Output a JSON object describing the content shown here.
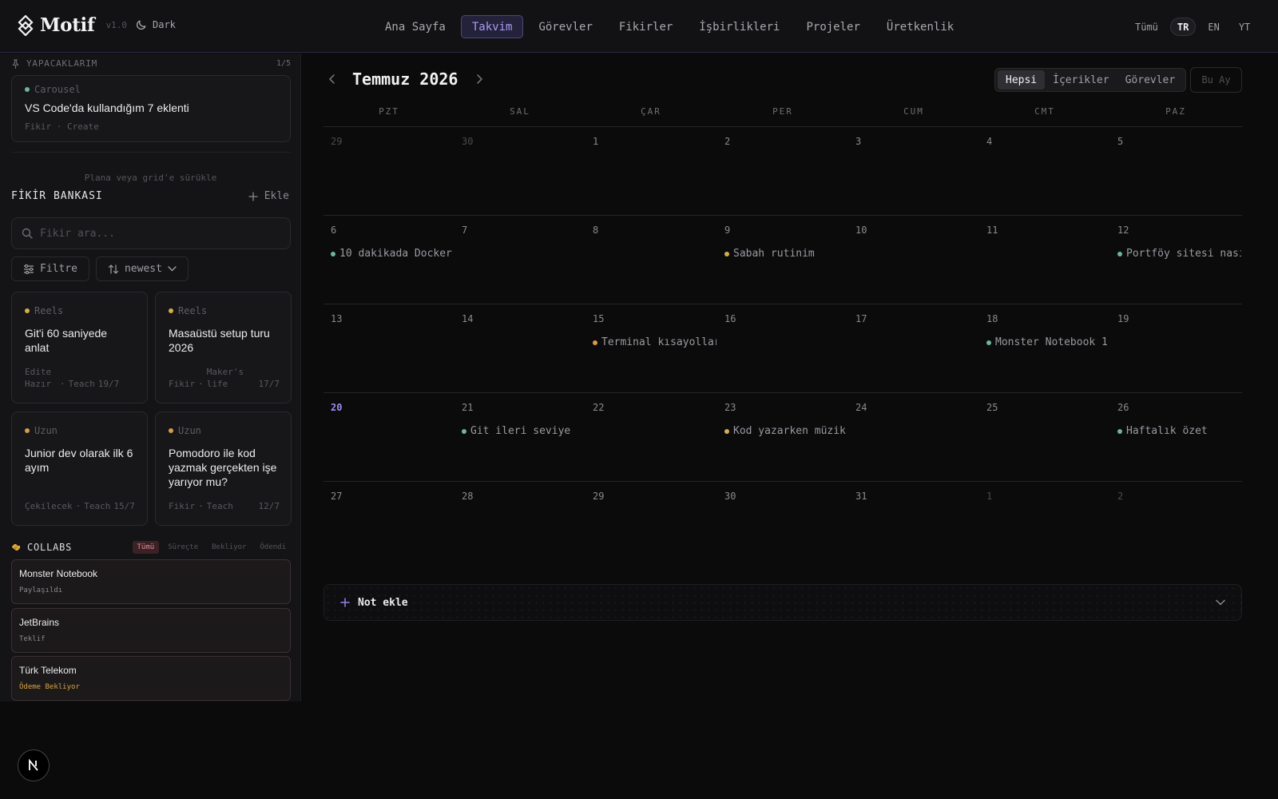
{
  "header": {
    "brand": "Motif",
    "version": "v1.0",
    "theme_label": "Dark",
    "nav": [
      "Ana Sayfa",
      "Takvim",
      "Görevler",
      "Fikirler",
      "İşbirlikleri",
      "Projeler",
      "Üretkenlik"
    ],
    "nav_active": "Takvim",
    "languages": [
      "Tümü",
      "TR",
      "EN",
      "YT"
    ],
    "language_active": "TR"
  },
  "sidebar": {
    "todo": {
      "title": "YAPACAKLARIM",
      "count": "1/5",
      "card": {
        "tag": "Carousel",
        "title": "VS Code'da kullandığım 7 eklenti",
        "meta": "Fikir · Create"
      }
    },
    "drag_hint": "Plana veya grid'e sürükle",
    "idea_bank": {
      "title": "FİKİR BANKASI",
      "add_label": "Ekle",
      "search_placeholder": "Fikir ara...",
      "filter_label": "Filtre",
      "sort_label": "newest",
      "cards": [
        {
          "tag": "Reels",
          "title": "Git'i 60 saniyede anlat",
          "status": "Edite Hazır",
          "category": "Teach",
          "date": "19/7"
        },
        {
          "tag": "Reels",
          "title": "Masaüstü setup turu 2026",
          "status": "Fikir",
          "category": "Maker's life",
          "date": "17/7"
        },
        {
          "tag": "Uzun",
          "title": "Junior dev olarak ilk 6 ayım",
          "status": "Çekilecek",
          "category": "Teach",
          "date": "15/7"
        },
        {
          "tag": "Uzun",
          "title": "Pomodoro ile kod yazmak gerçekten işe yarıyor mu?",
          "status": "Fikir",
          "category": "Teach",
          "date": "12/7"
        }
      ]
    },
    "collabs": {
      "title": "COLLABS",
      "tabs": [
        "Tümü",
        "Süreçte",
        "Bekliyor",
        "Ödendi"
      ],
      "tab_active": "Tümü",
      "items": [
        {
          "name": "Monster Notebook",
          "status": "Paylaşıldı"
        },
        {
          "name": "JetBrains",
          "status": "Teklif"
        },
        {
          "name": "Türk Telekom",
          "status": "Ödeme Bekliyor"
        }
      ]
    }
  },
  "calendar": {
    "title": "Temmuz 2026",
    "filters": [
      "Hepsi",
      "İçerikler",
      "Görevler"
    ],
    "filter_active": "Hepsi",
    "this_month_label": "Bu Ay",
    "weekdays": [
      "PZT",
      "SAL",
      "ÇAR",
      "PER",
      "CUM",
      "CMT",
      "PAZ"
    ],
    "weeks": [
      [
        {
          "day": "29",
          "other": true
        },
        {
          "day": "30",
          "other": true
        },
        {
          "day": "1"
        },
        {
          "day": "2"
        },
        {
          "day": "3"
        },
        {
          "day": "4"
        },
        {
          "day": "5"
        }
      ],
      [
        {
          "day": "6",
          "event": "10 dakikada Docker",
          "event_type": "green"
        },
        {
          "day": "7"
        },
        {
          "day": "8"
        },
        {
          "day": "9",
          "event": "Sabah rutinim",
          "event_type": "yellow"
        },
        {
          "day": "10"
        },
        {
          "day": "11"
        },
        {
          "day": "12",
          "event": "Portföy sitesi nasıl",
          "event_type": "green"
        }
      ],
      [
        {
          "day": "13"
        },
        {
          "day": "14"
        },
        {
          "day": "15",
          "event": "Terminal kısayolları",
          "event_type": "orange"
        },
        {
          "day": "16"
        },
        {
          "day": "17"
        },
        {
          "day": "18",
          "event": "Monster Notebook 1",
          "event_type": "green"
        },
        {
          "day": "19"
        }
      ],
      [
        {
          "day": "20",
          "today": true
        },
        {
          "day": "21",
          "event": "Git ileri seviye",
          "event_type": "green"
        },
        {
          "day": "22"
        },
        {
          "day": "23",
          "event": "Kod yazarken müzik",
          "event_type": "yellow"
        },
        {
          "day": "24"
        },
        {
          "day": "25"
        },
        {
          "day": "26",
          "event": "Haftalık özet",
          "event_type": "green"
        }
      ],
      [
        {
          "day": "27"
        },
        {
          "day": "28"
        },
        {
          "day": "29"
        },
        {
          "day": "30"
        },
        {
          "day": "31"
        },
        {
          "day": "1",
          "other": true
        },
        {
          "day": "2",
          "other": true
        }
      ]
    ],
    "note_label": "Not ekle"
  },
  "colors": {
    "accent": "#9a8df0",
    "nav_active_bg": "#24213a",
    "green": "#6fb59a",
    "yellow": "#d6ad4e",
    "orange": "#d99a4e",
    "collab_tab_active": "#e58a96",
    "payment_pending": "#d9a441"
  },
  "icons": {
    "logo": "motif-diamond-logo",
    "theme": "moon-icon",
    "todo": "pin-icon",
    "add": "plus-icon",
    "search": "search-icon",
    "filter": "sliders-icon",
    "sort": "sort-arrows-icon",
    "collabs": "handshake-icon",
    "prev": "chevron-left-icon",
    "next": "chevron-right-icon",
    "note_expand": "chevron-down-icon",
    "dev_badge": "next-logo-icon"
  }
}
